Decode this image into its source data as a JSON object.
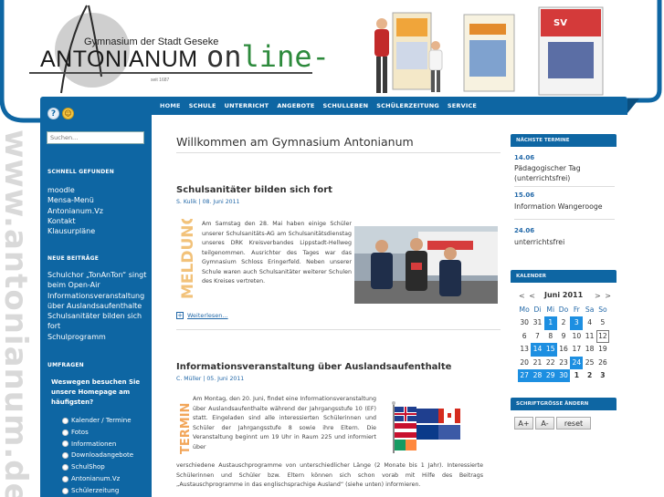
{
  "header": {
    "school_name": "Gymnasium der Stadt Geseke",
    "logo_main": "ANTONIANUM",
    "logo_online_prefix": "on",
    "logo_online_suffix": "line-",
    "since": "seit 1687",
    "side_domain": "www.antonianum.de"
  },
  "nav": {
    "items": [
      {
        "label": "Home"
      },
      {
        "label": "Schule"
      },
      {
        "label": "Unterricht"
      },
      {
        "label": "Angebote"
      },
      {
        "label": "Schulleben"
      },
      {
        "label": "Schülerzeitung"
      },
      {
        "label": "Service"
      }
    ]
  },
  "left": {
    "search_placeholder": "Suchen...",
    "quick_heading": "Schnell gefunden",
    "quick_links": [
      "moodle",
      "Mensa-Menü",
      "Antonianum.Vz",
      "Kontakt",
      "Klausurpläne"
    ],
    "new_heading": "Neue Beiträge",
    "new_posts": [
      "Schulchor „TonAnTon“ singt",
      "beim Open-Air",
      "Informationsveranstaltung",
      "über Auslandsaufenthalte",
      "Schulsanitäter bilden sich",
      "fort",
      "Schulprogramm"
    ],
    "poll_heading": "Umfragen",
    "poll_question": "Weswegen besuchen Sie unsere Homepage am häufigsten?",
    "poll_options": [
      "Kalender / Termine",
      "Fotos",
      "Informationen",
      "Downloadangebote",
      "SchulShop",
      "Antonianum.Vz",
      "Schülerzeitung"
    ]
  },
  "main": {
    "title": "Willkommen am Gymnasium Antonianum",
    "articles": [
      {
        "title": "Schulsanitäter bilden sich fort",
        "meta": "S. Kulik | 08. Juni 2011",
        "stamp": "MELDUNG",
        "body": "Am Samstag den 28. Mai haben einige Schüler unserer Schulsanitäts-AG am Schulsanitätsdienstag unseres DRK Kreisverbandes Lippstadt-Hellweg teilgenommen. Ausrichter des Tages war das Gymnasium Schloss Eringerfeld. Neben unserer Schule waren auch Schulsanitäter weiterer Schulen des Kreises vertreten.",
        "read_more": "Weiterlesen..."
      },
      {
        "title": "Informationsveranstaltung über Auslandsaufenthalte",
        "meta": "C. Müller | 05. Juni 2011",
        "stamp": "TERMIN",
        "body_top": "Am Montag, den 20. Juni, findet eine Informationsveranstaltung über Auslandsaufenthalte während der Jahrgangsstufe 10 (EF) statt. Eingeladen sind alle interessierten Schülerinnen und Schüler der Jahrgangsstufe 8 sowie ihre Eltern. Die Veranstaltung beginnt um 19 Uhr in Raum 225 und informiert über",
        "body_bottom": "verschiedene Austauschprogramme von unterschiedlicher Länge (2 Monate bis 1 Jahr). Interessierte Schülerinnen und Schüler bzw. Eltern können sich schon vorab mit Hilfe des Beitrags „Austauschprogramme in das englischsprachige Ausland“ (siehe unten) informieren."
      }
    ]
  },
  "right": {
    "events_heading": "Nächste Termine",
    "events": [
      {
        "date": "14.06",
        "lines": [
          "Pädagogischer Tag",
          "(unterrichtsfrei)"
        ]
      },
      {
        "date": "15.06",
        "lines": [
          "Information Wangerooge"
        ]
      },
      {
        "date": "24.06",
        "lines": [
          "unterrichtsfrei"
        ]
      }
    ],
    "calendar_heading": "Kalender",
    "calendar": {
      "prev": "< <",
      "next": "> >",
      "month": "Juni 2011",
      "weekdays": [
        "Mo",
        "Di",
        "Mi",
        "Do",
        "Fr",
        "Sa",
        "So"
      ],
      "days": [
        "30",
        "31",
        "1",
        "2",
        "3",
        "4",
        "5",
        "6",
        "7",
        "8",
        "9",
        "10",
        "11",
        "12",
        "13",
        "14",
        "15",
        "16",
        "17",
        "18",
        "19",
        "20",
        "21",
        "22",
        "23",
        "24",
        "25",
        "26",
        "27",
        "28",
        "29",
        "30",
        "1",
        "2",
        "3"
      ],
      "highlighted": [
        "1",
        "3",
        "14",
        "15",
        "24",
        "27",
        "28",
        "29",
        "30"
      ],
      "today": "12"
    },
    "font_heading": "Schriftgröße ändern",
    "font_buttons": {
      "increase": "A+",
      "decrease": "A-",
      "reset": "reset"
    }
  }
}
